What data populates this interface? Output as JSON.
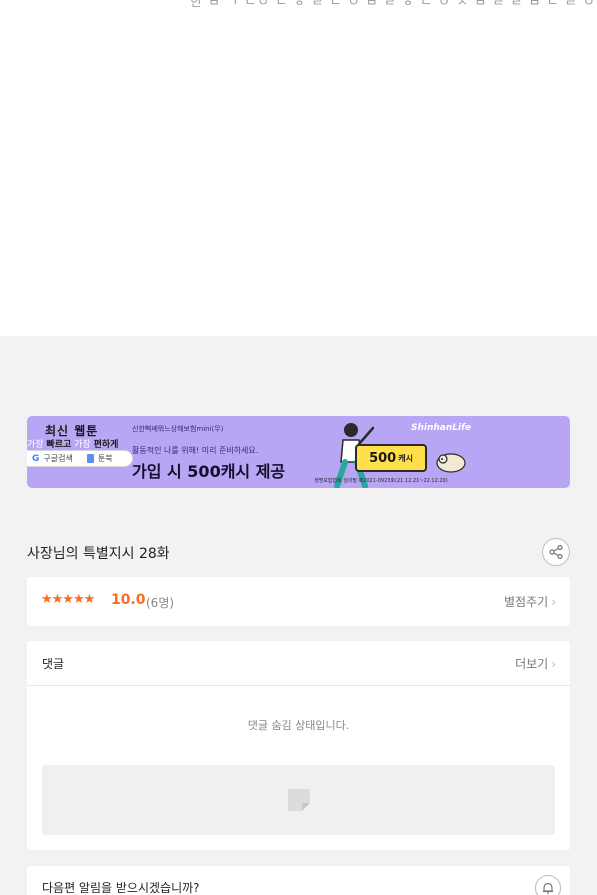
{
  "top_fragment": {
    "text": "한 ㅂ ㄱ ㄴㅇ ㄴ ㅎ ㄹ ㄴ ㅇ ㅂ ㄹ ㅎ ㄴ ㅇ ㅈ ㅂ ㄹ ㄹ ㅂ ㄴ ㄹ ㅇ ··········"
  },
  "ad": {
    "webtoon_title": "최신 웹툰",
    "webtoon_sub_fast": "빠르고",
    "webtoon_sub_easy": "편하게",
    "search_label": "구글검색",
    "ridi_label": "툰북",
    "brand": "신한뻑쎄뭐느상해보험mini(무)",
    "desc": "활동적인 나를 위해! 미리 준비하세요.",
    "headline": "가입 시 500캐시 제공",
    "cash_amount": "500",
    "cash_unit": "캐시",
    "shinhan": "ShinhanLife",
    "fine_print": "생명보험협회 심의필 제2021-0923호(21.12.21~22.12.20)",
    "bg_color": "#b8a6f4"
  },
  "episode": {
    "title": "사장님의 특별지시 28화",
    "share_icon": "share-icon"
  },
  "rating": {
    "stars": "★★★★★",
    "score": "10.0",
    "count": "(6명)",
    "rate_label": "별점주기",
    "color": "#ff6a24"
  },
  "comments": {
    "title": "댓글",
    "more_label": "더보기",
    "hidden_message": "댓글 숨김 상태입니다."
  },
  "notify": {
    "question": "다음편 알림을 받으시겠습니까?",
    "bell_icon": "bell-icon"
  }
}
